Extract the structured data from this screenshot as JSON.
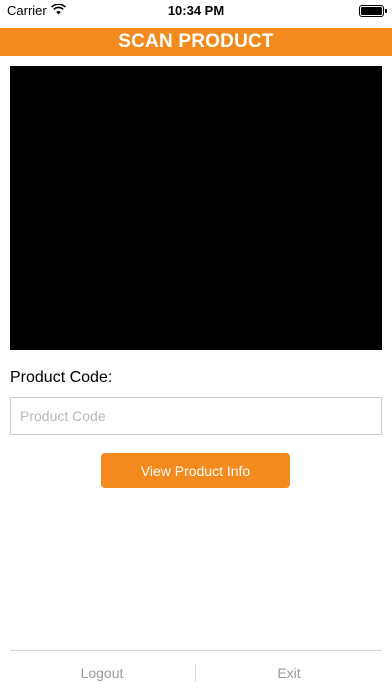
{
  "status_bar": {
    "carrier": "Carrier",
    "time": "10:34 PM",
    "wifi_icon": "wifi-icon",
    "battery_icon": "battery-full-icon"
  },
  "header": {
    "title": "SCAN PRODUCT"
  },
  "form": {
    "label": "Product Code:",
    "input_value": "",
    "input_placeholder": "Product Code",
    "submit_label": "View Product Info"
  },
  "footer": {
    "logout_label": "Logout",
    "exit_label": "Exit"
  },
  "colors": {
    "accent": "#f28a1d",
    "camera_background": "#000000",
    "footer_text": "#9a9a9a"
  }
}
